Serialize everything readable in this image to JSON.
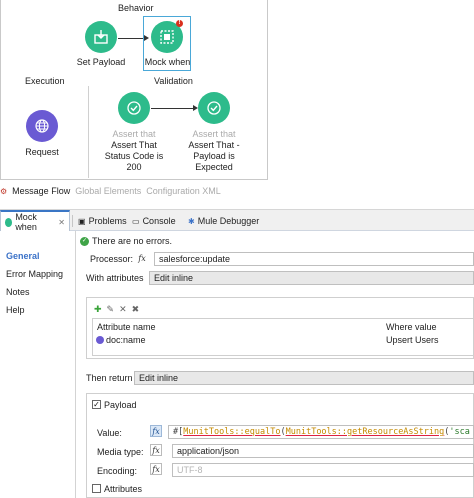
{
  "canvas": {
    "behavior_label": "Behavior",
    "execution_label": "Execution",
    "validation_label": "Validation",
    "nodes": {
      "set_payload": {
        "label": "Set Payload",
        "icon": "set-payload-icon",
        "color": "#2dbb8b"
      },
      "mock_when": {
        "label": "Mock when",
        "icon": "mock-when-icon",
        "color": "#2dbb8b",
        "error_badge": "!"
      },
      "request": {
        "label": "Request",
        "icon": "globe-icon",
        "color": "#6a5ad3"
      },
      "assert_status": {
        "kind": "Assert that",
        "label_line1": "Assert That",
        "label_line2": "Status Code is",
        "label_line3": "200",
        "icon": "check-icon"
      },
      "assert_payload": {
        "kind": "Assert that",
        "label_line1": "Assert That -",
        "label_line2": "Payload is",
        "label_line3": "Expected",
        "icon": "check-icon"
      }
    }
  },
  "flow_tabs": {
    "message_flow": "Message Flow",
    "global_elements": "Global Elements",
    "configuration_xml": "Configuration XML"
  },
  "editor_tabs": [
    {
      "label": "Mock when",
      "icon": "mock-when-icon",
      "active": true
    },
    {
      "label": "Problems",
      "icon": "problems-icon"
    },
    {
      "label": "Console",
      "icon": "console-icon"
    },
    {
      "label": "Mule Debugger",
      "icon": "debugger-icon"
    }
  ],
  "left_nav": [
    "General",
    "Error Mapping",
    "Notes",
    "Help"
  ],
  "status": "There are no errors.",
  "form": {
    "processor_label": "Processor:",
    "processor_value": "salesforce:update",
    "with_attributes_label": "With attributes",
    "with_attributes_value": "Edit inline",
    "attr_table": {
      "col_name": "Attribute name",
      "col_value": "Where value",
      "rows": [
        {
          "name": "doc:name",
          "value": "Upsert Users"
        }
      ]
    },
    "then_return_label": "Then return",
    "then_return_value": "Edit inline",
    "payload_label": "Payload",
    "value_label": "Value:",
    "value_prefix": "#[",
    "value_fn1": "MunitTools::equalTo",
    "value_paren": "(",
    "value_fn2": "MunitTools::getResourceAsString",
    "value_tail": "(",
    "value_str": "'sca",
    "media_type_label": "Media type:",
    "media_type_value": "application/json",
    "encoding_label": "Encoding:",
    "encoding_placeholder": "UTF-8",
    "attributes_label": "Attributes",
    "fx_label": "fx"
  },
  "colors": {
    "accent": "#3b72c8",
    "green_node": "#2dbb8b",
    "purple_node": "#6a5ad3",
    "error": "#d9301e"
  }
}
